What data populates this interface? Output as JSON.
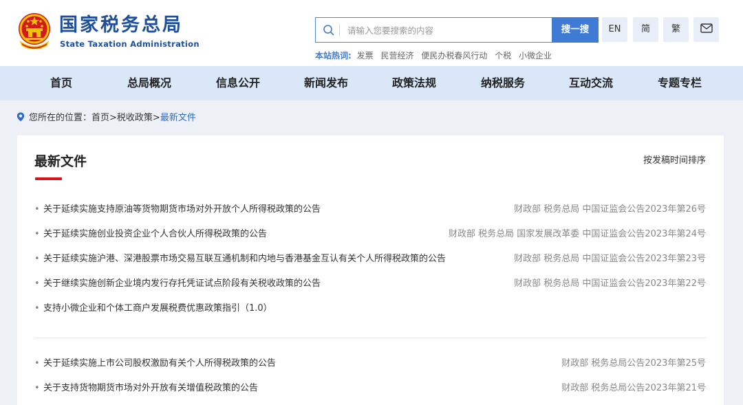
{
  "header": {
    "logo_cn": "国家税务总局",
    "logo_en": "State Taxation Administration",
    "search_placeholder": "请输入您要搜索的内容",
    "search_button": "搜一搜",
    "tools": [
      "EN",
      "简",
      "繁"
    ],
    "hot_label": "本站热词:",
    "hot_words": [
      "发票",
      "民营经济",
      "便民办税春风行动",
      "个税",
      "小微企业"
    ]
  },
  "nav": {
    "items": [
      "首页",
      "总局概况",
      "信息公开",
      "新闻发布",
      "政策法规",
      "纳税服务",
      "互动交流",
      "专题专栏"
    ]
  },
  "breadcrumb": {
    "prefix": "您所在的位置：",
    "path": "首页>税收政策>",
    "current": "最新文件"
  },
  "panel": {
    "title": "最新文件",
    "sort": "按发稿时间排序",
    "group1": [
      {
        "title": "关于延续实施支持原油等货物期货市场对外开放个人所得税政策的公告",
        "doc": "财政部 税务总局 中国证监会公告2023年第26号"
      },
      {
        "title": "关于延续实施创业投资企业个人合伙人所得税政策的公告",
        "doc": "财政部 税务总局 国家发展改革委 中国证监会公告2023年第24号"
      },
      {
        "title": "关于延续实施沪港、深港股票市场交易互联互通机制和内地与香港基金互认有关个人所得税政策的公告",
        "doc": "财政部 税务总局 中国证监会公告2023年第23号"
      },
      {
        "title": "关于继续实施创新企业境内发行存托凭证试点阶段有关税收政策的公告",
        "doc": "财政部 税务总局 中国证监会公告2023年第22号"
      },
      {
        "title": "支持小微企业和个体工商户发展税费优惠政策指引（1.0）",
        "doc": ""
      }
    ],
    "group2": [
      {
        "title": "关于延续实施上市公司股权激励有关个人所得税政策的公告",
        "doc": "财政部 税务总局公告2023年第25号"
      },
      {
        "title": "关于支持货物期货市场对外开放有关增值税政策的公告",
        "doc": "财政部 税务总局公告2023年第21号"
      }
    ]
  },
  "colors": {
    "brand_blue": "#1e4f9c",
    "accent_blue": "#3f7bd5",
    "nav_bg": "#d9e7f9",
    "page_bg": "#edf1f6",
    "title_underline": "#d6141c"
  }
}
